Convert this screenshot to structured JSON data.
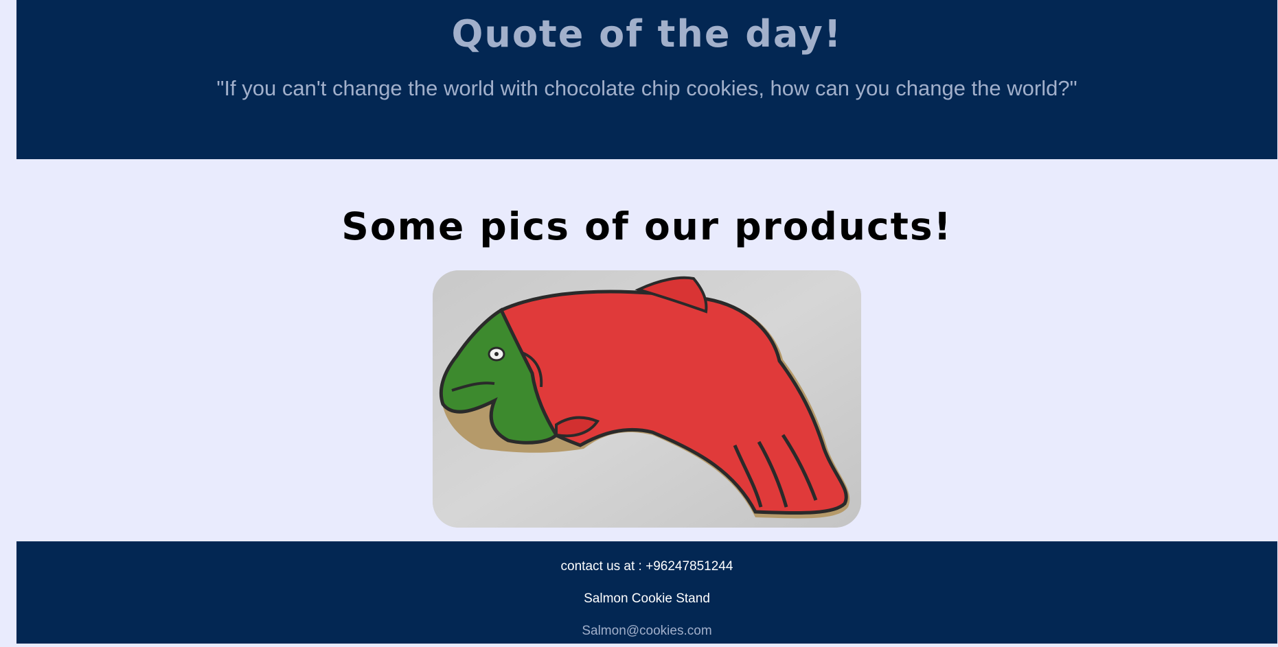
{
  "quote": {
    "title": "Quote of the day!",
    "text": "\"If you can't change the world with chocolate chip cookies, how can you change the world?\""
  },
  "products": {
    "title": "Some pics of our products!",
    "image_subject": "salmon-shaped-cookie"
  },
  "footer": {
    "contact": "contact us at : +96247851244",
    "name": "Salmon Cookie Stand",
    "email": "Salmon@cookies.com"
  },
  "colors": {
    "header_bg": "#032753",
    "page_bg": "#e9ebfd",
    "muted_text": "#a2b0cb",
    "footer_text": "#ffffff"
  }
}
